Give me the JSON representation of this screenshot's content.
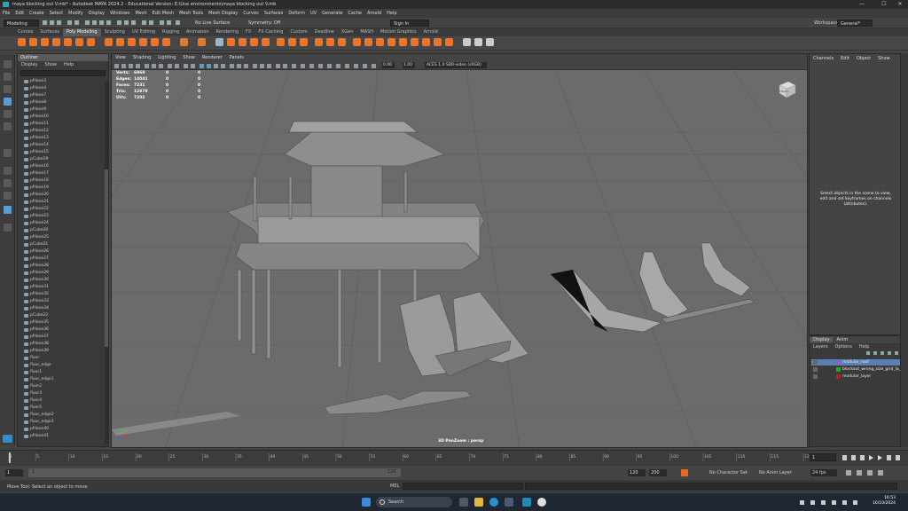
{
  "window": {
    "title": "maya blocking out V.mb* - Autodesk MAYA 2024.2 - Educational Version: E:\\Uue environments\\maya blocking out V.mb",
    "controls": [
      "—",
      "☐",
      "✕"
    ]
  },
  "menubar": [
    "File",
    "Edit",
    "Create",
    "Select",
    "Modify",
    "Display",
    "Windows",
    "Mesh",
    "Edit Mesh",
    "Mesh Tools",
    "Mesh Display",
    "Curves",
    "Surfaces",
    "Deform",
    "UV",
    "Generate",
    "Cache",
    "Arnold",
    "Help"
  ],
  "statusline": {
    "mode": "Modeling",
    "live_surface": "No Live Surface",
    "symmetry": "Symmetry: Off",
    "signin": "Sign In",
    "workspace_label": "Workspace :",
    "workspace": "General*"
  },
  "shelf_tabs": [
    "Curves",
    "Surfaces",
    "Poly Modeling",
    "Sculpting",
    "UV Editing",
    "Rigging",
    "Animation",
    "Rendering",
    "FX",
    "FX Caching",
    "Custom",
    "Deadline",
    "XGen",
    "MASH",
    "Motion Graphics",
    "Arnold"
  ],
  "shelf_active": "Poly Modeling",
  "outliner": {
    "title": "Outliner",
    "menu": [
      "Display",
      "Show",
      "Help"
    ],
    "items": [
      "pPlane3",
      "pPlane4",
      "pPlane7",
      "pPlane8",
      "pPlane9",
      "pPlane10",
      "pPlane11",
      "pPlane12",
      "pPlane13",
      "pPlane14",
      "pPlane15",
      "pCube19",
      "pPlane16",
      "pPlane17",
      "pPlane18",
      "pPlane19",
      "pPlane20",
      "pPlane21",
      "pPlane22",
      "pPlane23",
      "pPlane24",
      "pCube20",
      "pPlane25",
      "pCube21",
      "pPlane26",
      "pPlane27",
      "pPlane28",
      "pPlane29",
      "pPlane30",
      "pPlane31",
      "pPlane32",
      "pPlane33",
      "pPlane34",
      "pCube22",
      "pPlane35",
      "pPlane36",
      "pPlane37",
      "pPlane38",
      "pPlane39",
      "floor",
      "floor_edge",
      "floor1",
      "floor_edge1",
      "floor2",
      "floor3",
      "floor4",
      "floor5",
      "floor_edge2",
      "floor_edge3",
      "pPlane40",
      "pPlane41"
    ]
  },
  "viewport": {
    "menu": [
      "View",
      "Shading",
      "Lighting",
      "Show",
      "Renderer",
      "Panels"
    ],
    "exposure": "0.00",
    "gamma": "1.00",
    "colorspace": "ACES 1.0 SDR-video (sRGB)",
    "hud": [
      {
        "label": "Verts:",
        "a": "6960",
        "b": "0",
        "c": "0"
      },
      {
        "label": "Edges:",
        "a": "14041",
        "b": "0",
        "c": "0"
      },
      {
        "label": "Faces:",
        "a": "7231",
        "b": "0",
        "c": "0"
      },
      {
        "label": "Tris:",
        "a": "12878",
        "b": "0",
        "c": "0"
      },
      {
        "label": "UVs:",
        "a": "7202",
        "b": "0",
        "c": "0"
      }
    ],
    "camera_label": "3D PanZoom : persp",
    "viewcube_label": "FRONT"
  },
  "channel_box": {
    "menu": [
      "Channels",
      "Edit",
      "Object",
      "Show"
    ],
    "message": "Select objects in the scene to view, edit and set keyframes on channels (attributes)."
  },
  "layers": {
    "tabs": [
      "Display",
      "Anim"
    ],
    "menu": [
      "Layers",
      "Options",
      "Help"
    ],
    "items": [
      {
        "name": "modular_roof",
        "color": "#9b59d0",
        "selected": true
      },
      {
        "name": "blockout_wrong_size_grid_la_ref",
        "color": "#00c000",
        "selected": false
      },
      {
        "name": "modular_layer",
        "color": "#d0102a",
        "selected": false
      }
    ]
  },
  "timeline": {
    "ticks": [
      "1",
      "5",
      "10",
      "15",
      "20",
      "25",
      "30",
      "35",
      "40",
      "45",
      "50",
      "55",
      "60",
      "65",
      "70",
      "75",
      "80",
      "85",
      "90",
      "95",
      "100",
      "105",
      "110",
      "115",
      "120"
    ],
    "current_frame": "1",
    "range_start": "1",
    "range_inner_start": "1",
    "range_inner_end": "120",
    "range_end_a": "120",
    "range_end_b": "200",
    "character_set": "No Character Set",
    "anim_layer": "No Anim Layer",
    "fps": "24 fps"
  },
  "command_line": {
    "lang": "MEL",
    "help": "Move Tool: Select an object to move."
  },
  "taskbar": {
    "search": "Search",
    "time": "16:53",
    "date": "16/10/2024"
  }
}
